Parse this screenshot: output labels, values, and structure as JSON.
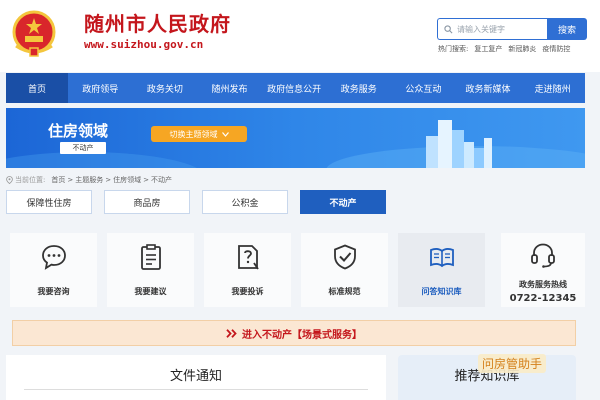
{
  "header": {
    "site_title": "随州市人民政府",
    "site_url": "www.suizhou.gov.cn",
    "search": {
      "placeholder": "请输入关键字",
      "button": "搜索"
    },
    "hot_search_label": "热门搜索:",
    "hot_searches": [
      "复工复产",
      "新冠肺炎",
      "疫情防控"
    ]
  },
  "nav": {
    "items": [
      {
        "label": "首页",
        "active": true
      },
      {
        "label": "政府领导"
      },
      {
        "label": "政务关切"
      },
      {
        "label": "随州发布"
      },
      {
        "label": "政府信息公开"
      },
      {
        "label": "政务服务"
      },
      {
        "label": "公众互动"
      },
      {
        "label": "政务新媒体"
      },
      {
        "label": "走进随州"
      }
    ]
  },
  "banner": {
    "title": "住房领域",
    "subtitle": "不动产",
    "switch_label": "切换主题领域"
  },
  "breadcrumb": {
    "label": "当前位置:",
    "items": [
      "首页",
      "主题服务",
      "住房领域",
      "不动产"
    ],
    "separator": ">"
  },
  "tabs": [
    {
      "label": "保障性住房"
    },
    {
      "label": "商品房"
    },
    {
      "label": "公积金"
    },
    {
      "label": "不动产",
      "active": true
    }
  ],
  "services": [
    {
      "label": "我要咨询",
      "icon": "chat-bubble-icon"
    },
    {
      "label": "我要建议",
      "icon": "clipboard-icon"
    },
    {
      "label": "我要投诉",
      "icon": "complaint-question-icon"
    },
    {
      "label": "标准规范",
      "icon": "shield-check-icon"
    },
    {
      "label": "问答知识库",
      "icon": "open-book-icon",
      "active": true
    }
  ],
  "hotline": {
    "label": "政务服务热线",
    "number": "0722-12345",
    "icon": "headset-icon"
  },
  "scene_bar": {
    "icon": "double-chevron-right",
    "text": "进入不动产【场景式服务】"
  },
  "sections": {
    "file_notice": "文件通知",
    "recommend": "推荐知识库"
  },
  "watermark": "问房管助手",
  "colors": {
    "brand_red": "#c4161c",
    "nav_blue": "#2d6fd3",
    "nav_active": "#1a4fa6",
    "tab_active": "#1f5fbf",
    "switch_orange": "#f6a623"
  }
}
